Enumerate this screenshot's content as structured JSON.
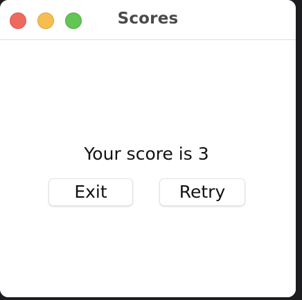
{
  "window": {
    "title": "Scores"
  },
  "dialog": {
    "message": "Your score is 3",
    "exit_label": "Exit",
    "retry_label": "Retry"
  },
  "colors": {
    "close": "#ee6a5f",
    "minimize": "#f5be4f",
    "zoom": "#62c554"
  }
}
